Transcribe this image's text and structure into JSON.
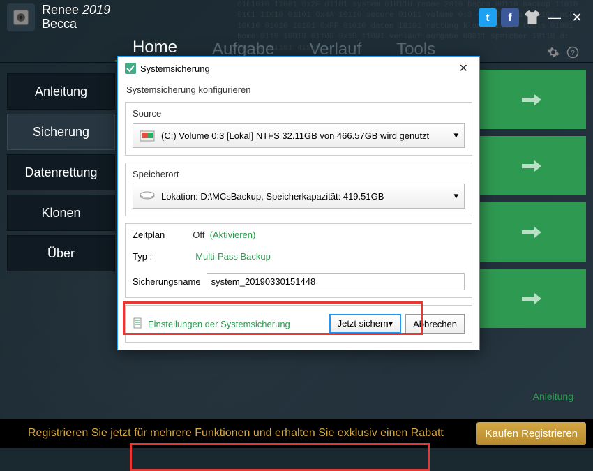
{
  "app": {
    "name1": "Renee ",
    "year": "2019",
    "name2": "Becca"
  },
  "nav": {
    "tabs": [
      "Home",
      "Aufgabe",
      "Verlauf",
      "Tools"
    ]
  },
  "sidebar": {
    "items": [
      "Anleitung",
      "Sicherung",
      "Datenrettung",
      "Klonen",
      "Über"
    ]
  },
  "help_link": "Anleitung",
  "promo": {
    "text": "Registrieren Sie jetzt für mehrere Funktionen und erhalten Sie exklusiv einen Rabatt",
    "button": "Kaufen Registrieren"
  },
  "dialog": {
    "title": "Systemsicherung",
    "subtitle": "Systemsicherung konfigurieren",
    "source": {
      "label": "Source",
      "value": "(C:) Volume 0:3 [Lokal] NTFS   32.11GB von 466.57GB wird genutzt"
    },
    "dest": {
      "label": "Speicherort",
      "value": "Lokation: D:\\MCsBackup, Speicherkapazität: 419.51GB"
    },
    "schedule": {
      "label": "Zeitplan",
      "off": "Off",
      "activate": "(Aktivieren)"
    },
    "type": {
      "label": "Typ :",
      "value": "Multi-Pass Backup"
    },
    "name": {
      "label": "Sicherungsname",
      "value": "system_20190330151448"
    },
    "settings_link": "Einstellungen der Systemsicherung",
    "btn_primary": "Jetzt sichern",
    "btn_cancel": "Abbrechen"
  },
  "bg_numbers": "0101010 11001 0x2F 01101 system 010110 renee 2019 becca 00110 backup 11010 0101\n11010 01101 0x4A 10110 secure 01011 volume 0:3 466GB lokal 00101 ntfs 10010\n01010 10101 0xFF 01010 daten 10101 rettung klonen 11100 tools 01001 home 0110\n10010 01100 0x1B 11001 verlauf aufgabe 00011 speicher 10110 d: backup 01101 419GB"
}
